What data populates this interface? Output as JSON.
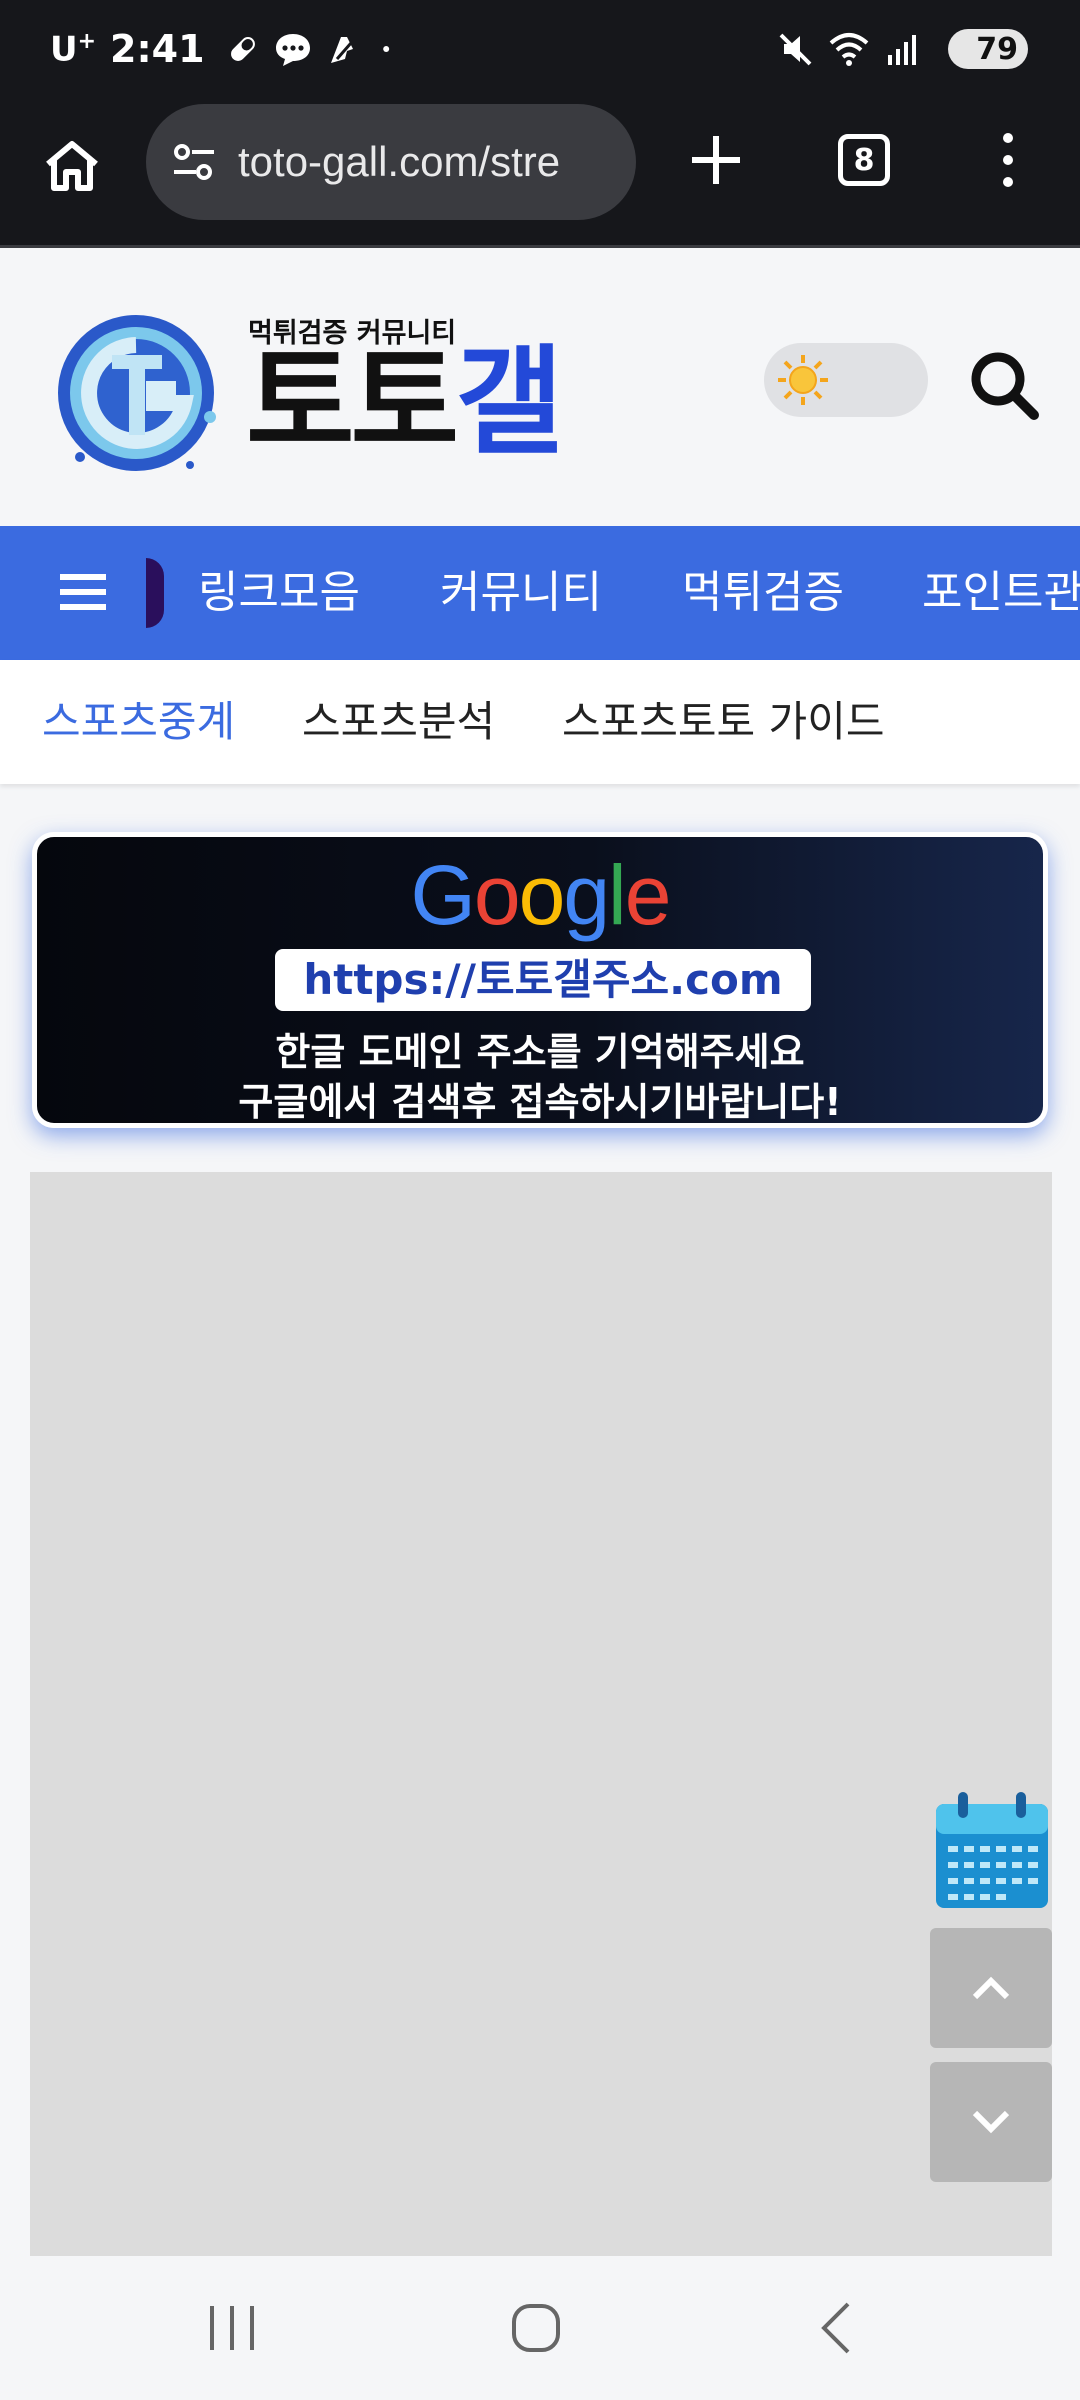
{
  "status_bar": {
    "carrier": "U",
    "carrier_sup": "+",
    "time": "2:41",
    "battery": "79"
  },
  "browser": {
    "url": "toto-gall.com/stre",
    "tab_count": "8"
  },
  "logo": {
    "tagline": "먹튀검증 커뮤니티",
    "name_black": "토토",
    "name_blue": "갤"
  },
  "main_nav": {
    "items": [
      "링크모음",
      "커뮤니티",
      "먹튀검증",
      "포인트관"
    ]
  },
  "sub_nav": {
    "items": [
      "스포츠중계",
      "스포츠분석",
      "스포츠토토 가이드"
    ],
    "active_index": 0
  },
  "banner": {
    "google": [
      "G",
      "o",
      "o",
      "g",
      "l",
      "e"
    ],
    "url": "https://토토갤주소.com",
    "line1": "한글 도메인 주소를 기억해주세요",
    "line2": "구글에서 검색후 접속하시기바랍니다!"
  },
  "colors": {
    "nav_blue": "#3b6be0",
    "logo_blue": "#2349d8",
    "status_bg": "#16171b"
  },
  "icons": {
    "home": "home-icon",
    "site_settings": "tune-icon",
    "new_tab": "plus-icon",
    "menu": "more-vert-icon",
    "theme": "sun-icon",
    "search": "search-icon",
    "nav_menu": "hamburger-icon",
    "calendar": "calendar-icon",
    "scroll_up": "chevron-up-icon",
    "scroll_down": "chevron-down-icon"
  }
}
